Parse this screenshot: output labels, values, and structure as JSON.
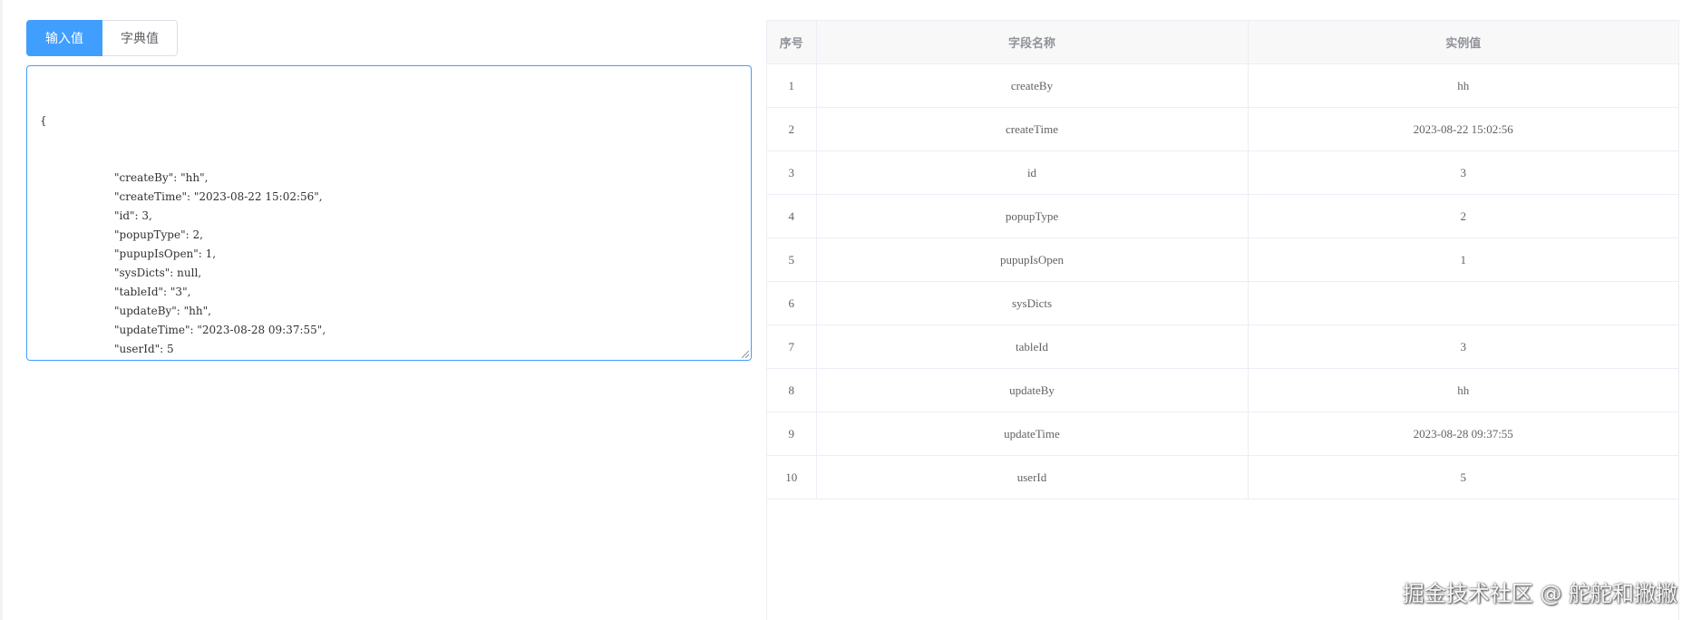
{
  "tabs": {
    "input_label": "输入值",
    "dict_label": "字典值"
  },
  "editor": {
    "open_brace": "{",
    "lines": [
      "\"createBy\": \"hh\",",
      "\"createTime\": \"2023-08-22 15:02:56\",",
      "\"id\": 3,",
      "\"popupType\": 2,",
      "\"pupupIsOpen\": 1,",
      "\"sysDicts\": null,",
      "\"tableId\": \"3\",",
      "\"updateBy\": \"hh\",",
      "\"updateTime\": \"2023-08-28 09:37:55\",",
      "\"userId\": 5"
    ],
    "close_brace": "}"
  },
  "table": {
    "headers": {
      "index": "序号",
      "field_name": "字段名称",
      "example_value": "实例值"
    },
    "rows": [
      {
        "index": "1",
        "field_name": "createBy",
        "example_value": "hh"
      },
      {
        "index": "2",
        "field_name": "createTime",
        "example_value": "2023-08-22 15:02:56"
      },
      {
        "index": "3",
        "field_name": "id",
        "example_value": "3"
      },
      {
        "index": "4",
        "field_name": "popupType",
        "example_value": "2"
      },
      {
        "index": "5",
        "field_name": "pupupIsOpen",
        "example_value": "1"
      },
      {
        "index": "6",
        "field_name": "sysDicts",
        "example_value": ""
      },
      {
        "index": "7",
        "field_name": "tableId",
        "example_value": "3"
      },
      {
        "index": "8",
        "field_name": "updateBy",
        "example_value": "hh"
      },
      {
        "index": "9",
        "field_name": "updateTime",
        "example_value": "2023-08-28 09:37:55"
      },
      {
        "index": "10",
        "field_name": "userId",
        "example_value": "5"
      }
    ]
  },
  "watermark": "掘金技术社区 @ 舵舵和撇撇",
  "colors": {
    "accent": "#409eff",
    "border": "#ebeef5",
    "header_bg": "#f8f8f9"
  }
}
